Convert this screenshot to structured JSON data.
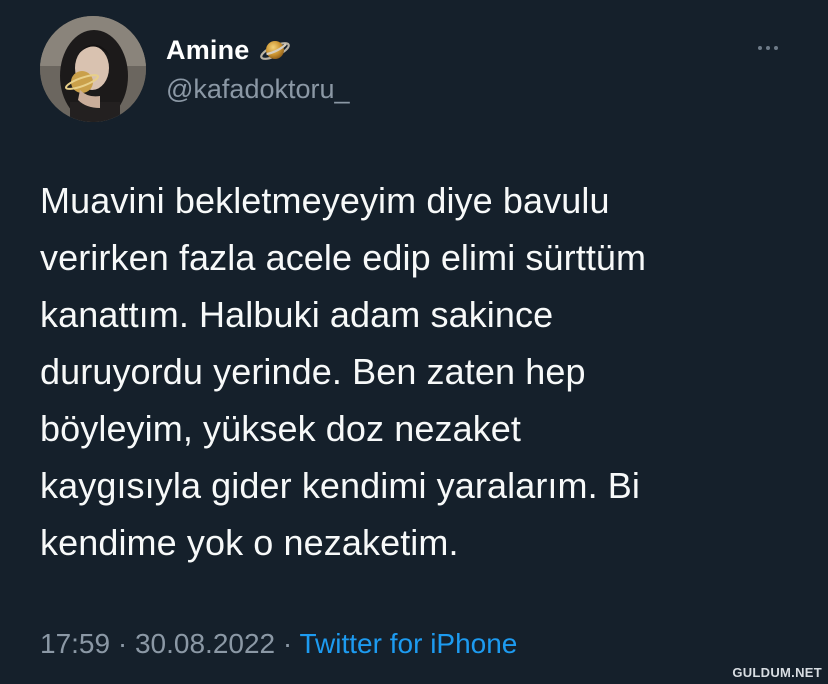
{
  "user": {
    "display_name": "Amine",
    "handle": "@kafadoktoru_",
    "badge_icon": "planet-icon",
    "avatar_icon": "profile-photo"
  },
  "tweet": {
    "text": "Muavini bekletmeyeyim diye bavulu\nverirken fazla acele edip elimi sürttüm\nkanattım. Halbuki adam sakince\nduruyordu yerinde. Ben zaten hep\nböyleyim, yüksek doz nezaket\nkaygısıyla gider kendimi yaralarım. Bi\nkendime yok o nezaketim."
  },
  "meta": {
    "time": "17:59",
    "separator": " · ",
    "date": "30.08.2022",
    "source": "Twitter for iPhone"
  },
  "more_icon": "more-horizontal-icon",
  "watermark": "GULDUM.NET",
  "colors": {
    "background": "#15202b",
    "secondary_text": "#8b98a5",
    "link": "#1d9bf0"
  }
}
